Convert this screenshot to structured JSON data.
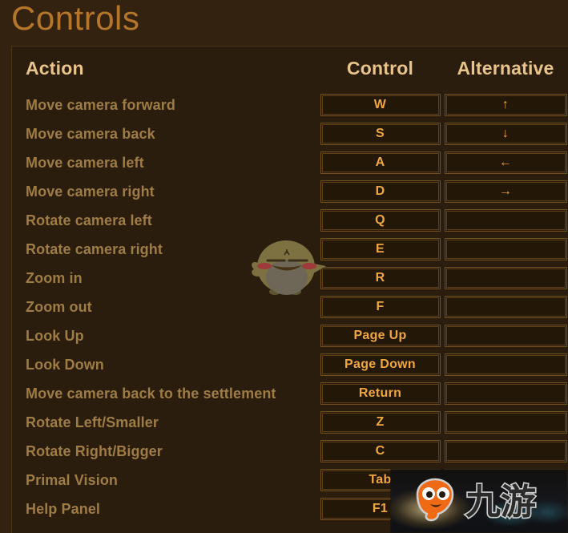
{
  "page": {
    "title": "Controls"
  },
  "table": {
    "headers": {
      "action": "Action",
      "control": "Control",
      "alternative": "Alternative"
    },
    "rows": [
      {
        "action": "Move camera forward",
        "control": "W",
        "alternative": "↑"
      },
      {
        "action": "Move camera back",
        "control": "S",
        "alternative": "↓"
      },
      {
        "action": "Move camera left",
        "control": "A",
        "alternative": "←"
      },
      {
        "action": "Move camera right",
        "control": "D",
        "alternative": "→"
      },
      {
        "action": "Rotate camera left",
        "control": "Q",
        "alternative": ""
      },
      {
        "action": "Rotate camera right",
        "control": "E",
        "alternative": ""
      },
      {
        "action": "Zoom in",
        "control": "R",
        "alternative": ""
      },
      {
        "action": "Zoom out",
        "control": "F",
        "alternative": ""
      },
      {
        "action": "Look Up",
        "control": "Page Up",
        "alternative": ""
      },
      {
        "action": "Look Down",
        "control": "Page Down",
        "alternative": ""
      },
      {
        "action": "Move camera back to the settlement",
        "control": "Return",
        "alternative": ""
      },
      {
        "action": "Rotate Left/Smaller",
        "control": "Z",
        "alternative": ""
      },
      {
        "action": "Rotate Right/Bigger",
        "control": "C",
        "alternative": ""
      },
      {
        "action": "Primal Vision",
        "control": "Tab",
        "alternative": ""
      },
      {
        "action": "Help Panel",
        "control": "F1",
        "alternative": ""
      }
    ]
  },
  "watermark": {
    "text": "九游",
    "logo_name": "jiuyou-mascot-logo"
  },
  "colors": {
    "page_background": "#33220f",
    "panel_background": "#2a1d0e",
    "title": "#b5762a",
    "header_text": "#e8c48b",
    "action_text": "#9e7c44",
    "key_text": "#f0a73f",
    "key_border": "#70501f",
    "key_fill": "#231708",
    "watermark_orange": "#ef6a14"
  }
}
